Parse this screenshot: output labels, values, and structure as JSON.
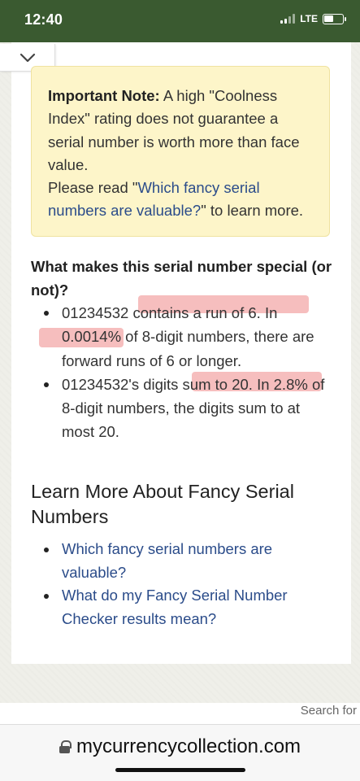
{
  "status_bar": {
    "time": "12:40",
    "network": "LTE",
    "icons": [
      "signal-icon",
      "battery-icon"
    ]
  },
  "collapse_toggle": {
    "icon": "chevron-down-icon"
  },
  "note": {
    "label": "Important Note:",
    "text": " A high \"Coolness Index\" rating does not guarantee a serial number is worth more than face value.",
    "read_prefix": "Please read \"",
    "link_text": "Which fancy serial numbers are valuable?",
    "read_suffix": "\" to learn more."
  },
  "special": {
    "heading": "What makes this serial number special (or not)?",
    "items": [
      "01234532 contains a run of 6. In 0.0014% of 8-digit numbers, there are forward runs of 6 or longer.",
      "01234532's digits sum to 20. In 2.8% of 8-digit numbers, the digits sum to at most 20."
    ]
  },
  "learn_more": {
    "heading": "Learn More About Fancy Serial Numbers",
    "links": [
      "Which fancy serial numbers are valuable?",
      "What do my Fancy Serial Number Checker results mean?"
    ]
  },
  "search_hint": "Search for",
  "browser": {
    "url": "mycurrencycollection.com",
    "lock_icon": "lock-icon"
  },
  "colors": {
    "status_bar": "#3a5a30",
    "note_bg": "#fdf5c9",
    "link": "#2b4c8a",
    "highlight": "#ec6e6e"
  }
}
